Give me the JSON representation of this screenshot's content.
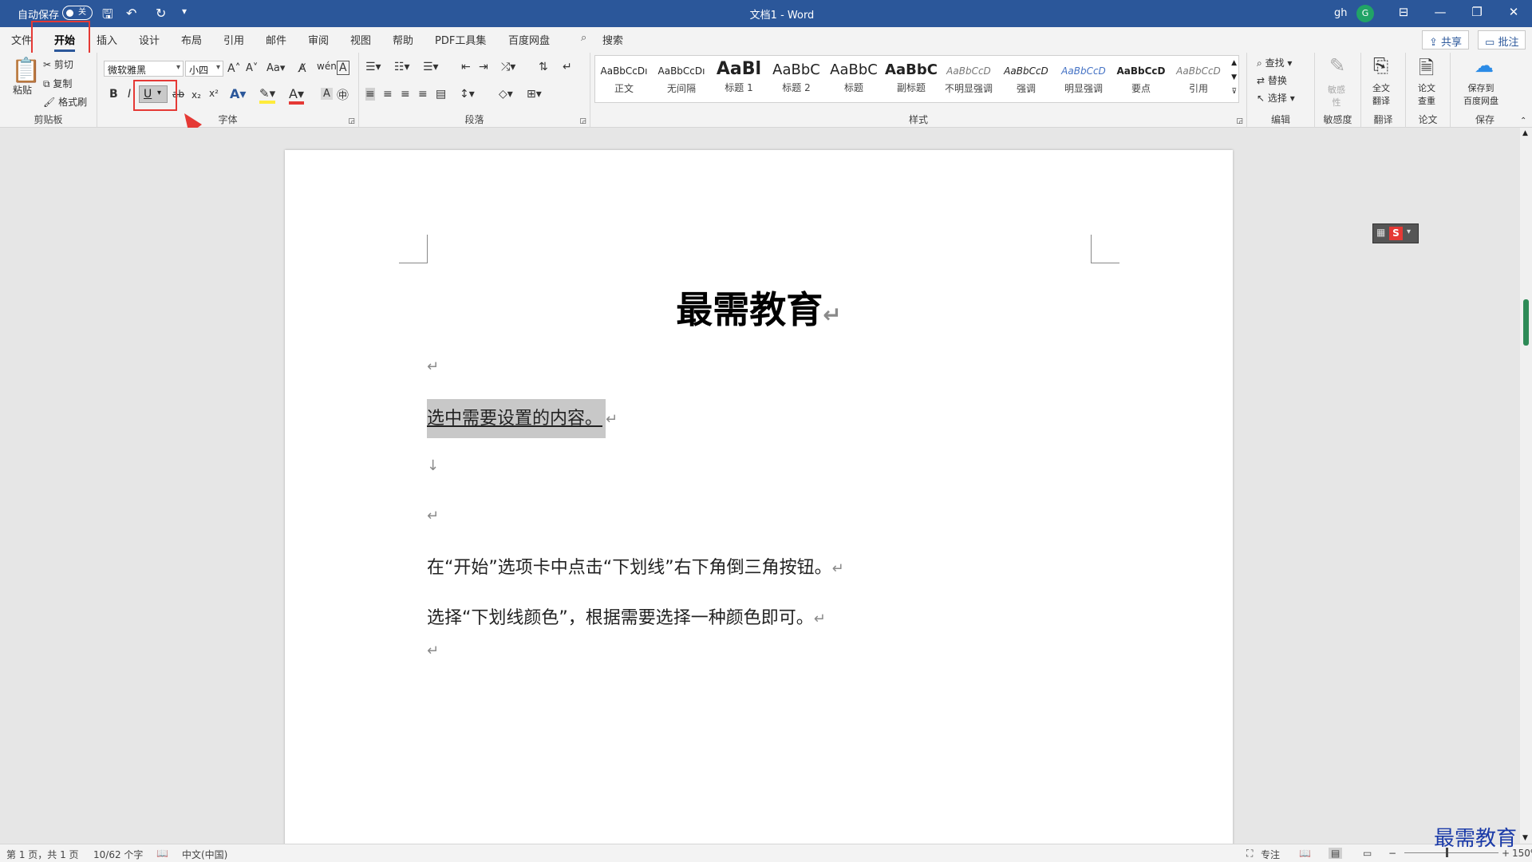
{
  "titlebar": {
    "autosave_label": "自动保存",
    "autosave_state": "关",
    "doc_title": "文档1  -  Word",
    "user": "gh",
    "avatar": "G"
  },
  "tabs": [
    "文件",
    "开始",
    "插入",
    "设计",
    "布局",
    "引用",
    "邮件",
    "审阅",
    "视图",
    "帮助",
    "PDF工具集",
    "百度网盘"
  ],
  "search_label": "搜索",
  "share_label": "共享",
  "comment_label": "批注",
  "clipboard": {
    "paste": "粘贴",
    "cut": "剪切",
    "copy": "复制",
    "format_painter": "格式刷",
    "group": "剪贴板"
  },
  "font": {
    "font_name": "微软雅黑",
    "font_size": "小四",
    "group": "字体",
    "bold": "B",
    "italic": "I",
    "underline": "U",
    "strike": "ab",
    "subscript": "x₂",
    "superscript": "x²"
  },
  "paragraph": {
    "group": "段落"
  },
  "styles": {
    "group": "样式",
    "items": [
      {
        "sample": "AaBbCcDı",
        "name": "正文"
      },
      {
        "sample": "AaBbCcDı",
        "name": "无间隔"
      },
      {
        "sample": "AaBl",
        "name": "标题 1"
      },
      {
        "sample": "AaBbC",
        "name": "标题 2"
      },
      {
        "sample": "AaBbC",
        "name": "标题"
      },
      {
        "sample": "AaBbC",
        "name": "副标题"
      },
      {
        "sample": "AaBbCcD",
        "name": "不明显强调"
      },
      {
        "sample": "AaBbCcD",
        "name": "强调"
      },
      {
        "sample": "AaBbCcD",
        "name": "明显强调"
      },
      {
        "sample": "AaBbCcD",
        "name": "要点"
      },
      {
        "sample": "AaBbCcD",
        "name": "引用"
      }
    ]
  },
  "editing": {
    "find": "查找",
    "replace": "替换",
    "select": "选择",
    "group": "编辑"
  },
  "sensitivity": {
    "label": "敏感\n性",
    "group": "敏感度"
  },
  "translate": {
    "label": "全文\n翻译",
    "group": "翻译"
  },
  "paper": {
    "label": "论文\n查重",
    "group": "论文"
  },
  "save": {
    "label": "保存到\n百度网盘",
    "group": "保存"
  },
  "document": {
    "title": "最需教育",
    "selected_text": "选中需要设置的内容。",
    "line1": "在“开始”选项卡中点击“下划线”右下角倒三角按钮。",
    "line2": "选择“下划线颜色”，根据需要选择一种颜色即可。",
    "para_mark": "↵",
    "line_break": "↓"
  },
  "status": {
    "page": "第 1 页，共 1 页",
    "words": "10/62 个字",
    "lang": "中文(中国)",
    "focus": "专注",
    "zoom": "150%"
  },
  "watermark": "最需教育",
  "colors": {
    "accent": "#2b579a",
    "highlight_box": "#e53935"
  }
}
